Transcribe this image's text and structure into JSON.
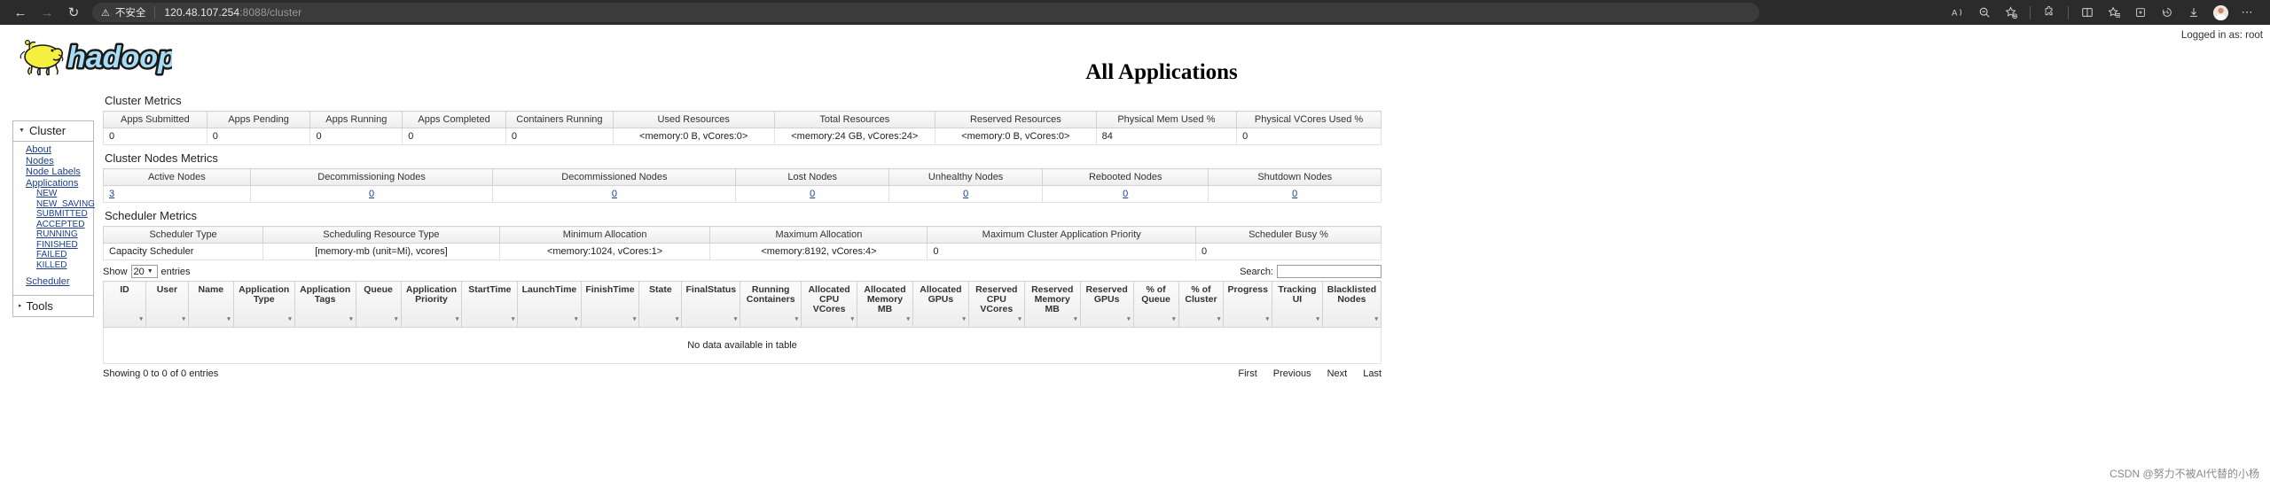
{
  "browser": {
    "back_icon": "back-arrow-icon",
    "forward_icon": "forward-arrow-icon",
    "reload_icon": "reload-icon",
    "security_warning": "不安全",
    "url_host": "120.48.107.254",
    "url_rest": ":8088/cluster",
    "right_icons": [
      {
        "name": "read-aloud-icon",
        "glyph": "A"
      },
      {
        "name": "zoom-out-icon",
        "glyph": "search"
      },
      {
        "name": "add-favorite-icon",
        "glyph": "star"
      },
      {
        "name": "extensions-icon",
        "glyph": "puzzle"
      },
      {
        "name": "split-screen-icon",
        "glyph": "split"
      },
      {
        "name": "favorites-icon",
        "glyph": "star-list"
      },
      {
        "name": "collections-icon",
        "glyph": "collections"
      },
      {
        "name": "history-icon",
        "glyph": "history"
      },
      {
        "name": "downloads-icon",
        "glyph": "download"
      },
      {
        "name": "profile-avatar",
        "glyph": "avatar"
      },
      {
        "name": "settings-more-icon",
        "glyph": "dots"
      }
    ]
  },
  "header": {
    "logo_text": "hadoop",
    "page_title": "All Applications",
    "logged_in_as": "Logged in as: root"
  },
  "sidebar": {
    "cluster_label": "Cluster",
    "items": [
      {
        "label": "About",
        "sub": false
      },
      {
        "label": "Nodes",
        "sub": false
      },
      {
        "label": "Node Labels",
        "sub": false
      },
      {
        "label": "Applications",
        "sub": false
      },
      {
        "label": "NEW",
        "sub": true
      },
      {
        "label": "NEW_SAVING",
        "sub": true
      },
      {
        "label": "SUBMITTED",
        "sub": true
      },
      {
        "label": "ACCEPTED",
        "sub": true
      },
      {
        "label": "RUNNING",
        "sub": true
      },
      {
        "label": "FINISHED",
        "sub": true
      },
      {
        "label": "FAILED",
        "sub": true
      },
      {
        "label": "KILLED",
        "sub": true
      }
    ],
    "scheduler_label": "Scheduler",
    "tools_label": "Tools"
  },
  "cluster_metrics": {
    "title": "Cluster Metrics",
    "headers": [
      "Apps Submitted",
      "Apps Pending",
      "Apps Running",
      "Apps Completed",
      "Containers Running",
      "Used Resources",
      "Total Resources",
      "Reserved Resources",
      "Physical Mem Used %",
      "Physical VCores Used %"
    ],
    "values": [
      "0",
      "0",
      "0",
      "0",
      "0",
      "<memory:0 B, vCores:0>",
      "<memory:24 GB, vCores:24>",
      "<memory:0 B, vCores:0>",
      "84",
      "0"
    ]
  },
  "node_metrics": {
    "title": "Cluster Nodes Metrics",
    "headers": [
      "Active Nodes",
      "Decommissioning Nodes",
      "Decommissioned Nodes",
      "Lost Nodes",
      "Unhealthy Nodes",
      "Rebooted Nodes",
      "Shutdown Nodes"
    ],
    "values": [
      "3",
      "0",
      "0",
      "0",
      "0",
      "0",
      "0"
    ]
  },
  "scheduler_metrics": {
    "title": "Scheduler Metrics",
    "headers": [
      "Scheduler Type",
      "Scheduling Resource Type",
      "Minimum Allocation",
      "Maximum Allocation",
      "Maximum Cluster Application Priority",
      "Scheduler Busy %"
    ],
    "values": [
      "Capacity Scheduler",
      "[memory-mb (unit=Mi), vcores]",
      "<memory:1024, vCores:1>",
      "<memory:8192, vCores:4>",
      "0",
      "0"
    ]
  },
  "datatable": {
    "show_label": "Show",
    "length_value": "20",
    "entries_label": "entries",
    "search_label": "Search:",
    "search_value": "",
    "columns": [
      "ID",
      "User",
      "Name",
      "Application Type",
      "Application Tags",
      "Queue",
      "Application Priority",
      "StartTime",
      "LaunchTime",
      "FinishTime",
      "State",
      "FinalStatus",
      "Running Containers",
      "Allocated CPU VCores",
      "Allocated Memory MB",
      "Allocated GPUs",
      "Reserved CPU VCores",
      "Reserved Memory MB",
      "Reserved GPUs",
      "% of Queue",
      "% of Cluster",
      "Progress",
      "Tracking UI",
      "Blacklisted Nodes"
    ],
    "empty_message": "No data available in table",
    "info_text": "Showing 0 to 0 of 0 entries",
    "pager": [
      "First",
      "Previous",
      "Next",
      "Last"
    ]
  },
  "watermark": "CSDN @努力不被AI代替的小杨"
}
